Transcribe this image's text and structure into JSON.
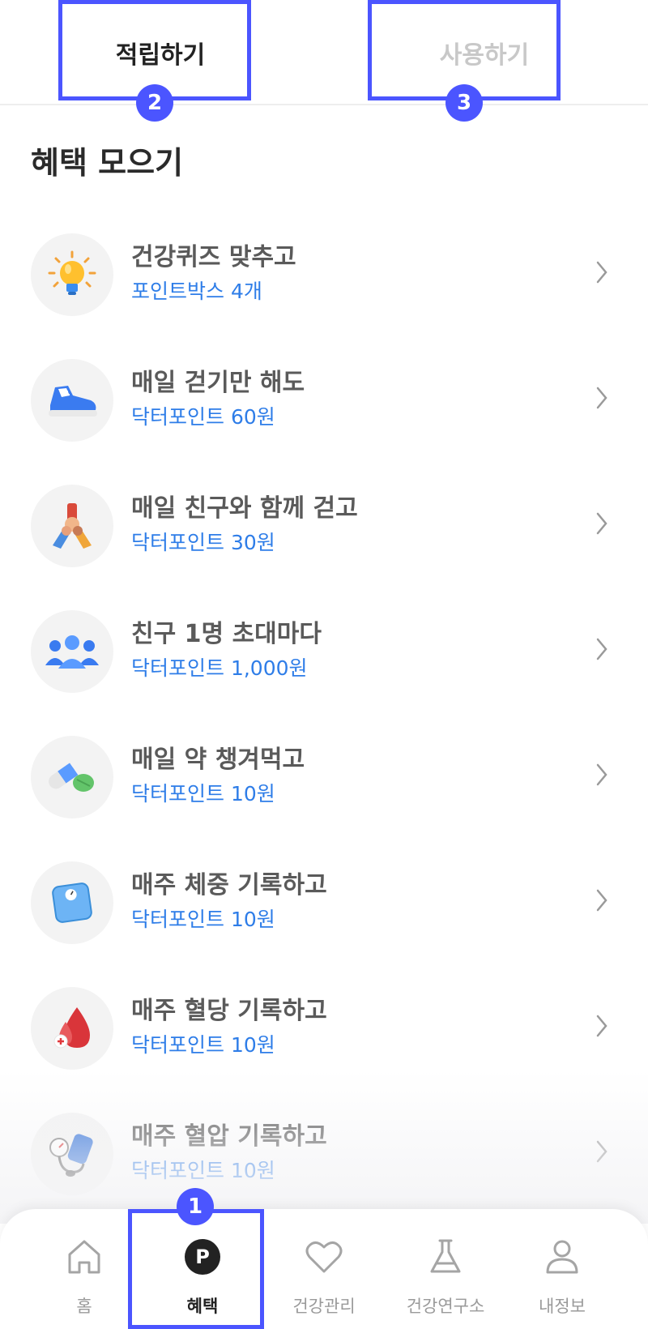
{
  "tabs": {
    "earn_label": "적립하기",
    "use_label": "사용하기"
  },
  "annotations": {
    "badge_1": "1",
    "badge_2": "2",
    "badge_3": "3",
    "highlight_color": "#4b55ff"
  },
  "section_title": "혜택 모으기",
  "benefits": [
    {
      "title": "건강퀴즈 맞추고",
      "reward": "포인트박스 4개",
      "icon": "lightbulb-icon"
    },
    {
      "title": "매일 걷기만 해도",
      "reward": "닥터포인트 60원",
      "icon": "sneaker-icon"
    },
    {
      "title": "매일 친구와 함께 걷고",
      "reward": "닥터포인트 30원",
      "icon": "stacked-hands-icon"
    },
    {
      "title": "친구 1명 초대마다",
      "reward": "닥터포인트 1,000원",
      "icon": "people-group-icon"
    },
    {
      "title": "매일 약 챙겨먹고",
      "reward": "닥터포인트 10원",
      "icon": "pills-icon"
    },
    {
      "title": "매주 체중 기록하고",
      "reward": "닥터포인트 10원",
      "icon": "scale-icon"
    },
    {
      "title": "매주 혈당 기록하고",
      "reward": "닥터포인트 10원",
      "icon": "blood-drop-icon"
    },
    {
      "title": "매주 혈압 기록하고",
      "reward": "닥터포인트 10원",
      "icon": "blood-pressure-monitor-icon"
    }
  ],
  "bottom_nav": [
    {
      "label": "홈",
      "icon": "home-icon",
      "active": false
    },
    {
      "label": "혜택",
      "icon": "point-icon",
      "active": true
    },
    {
      "label": "건강관리",
      "icon": "heart-icon",
      "active": false
    },
    {
      "label": "건강연구소",
      "icon": "flask-icon",
      "active": false
    },
    {
      "label": "내정보",
      "icon": "user-icon",
      "active": false
    }
  ],
  "colors": {
    "reward_text": "#2e7de8",
    "accent": "#4b55ff",
    "inactive_tab": "#c8c8c8"
  }
}
